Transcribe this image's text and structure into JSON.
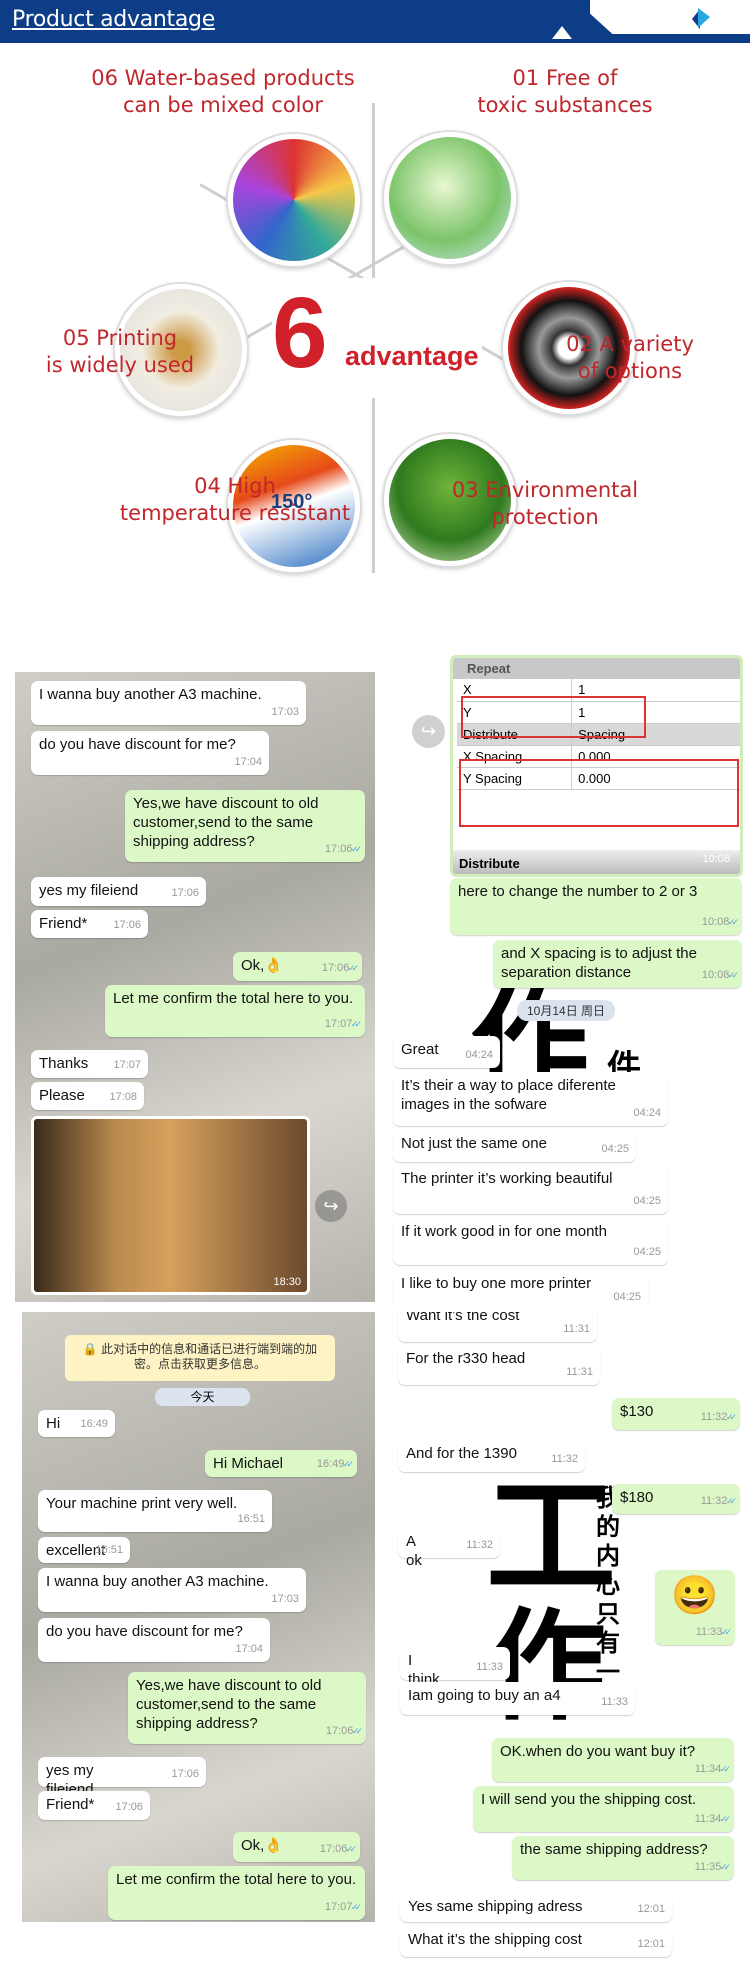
{
  "header": {
    "title": "Product advantage",
    "logo": "diamond-logo",
    "color": "#0d3d87"
  },
  "advantages": {
    "center_number": "6",
    "center_label": "advantage",
    "accent": "#c0262b",
    "items": [
      {
        "line1": "06 Water-based products",
        "line2": "can be mixed color",
        "image": "paint-brushes"
      },
      {
        "line1": "01 Free of",
        "line2": "toxic substances",
        "image": "lightbulb-plant"
      },
      {
        "line1": "05 Printing",
        "line2": "is widely used",
        "image": "pixel-deer"
      },
      {
        "line1": "02 A variety",
        "line2": "of options",
        "image": "metal-ring"
      },
      {
        "line1": "04 High",
        "line2": "temperature resistant",
        "image": "thermometer",
        "image_text": "150°"
      },
      {
        "line1": "03 Environmental",
        "line2": "protection",
        "image": "grass-house"
      }
    ]
  },
  "chats": {
    "top_left": {
      "messages": [
        {
          "dir": "in",
          "text": "I wanna buy another A3 machine.",
          "time": "17:03"
        },
        {
          "dir": "in",
          "text": "do you have discount for me?",
          "time": "17:04"
        },
        {
          "dir": "out",
          "text": "Yes,we have discount to old customer,send to the same shipping address?",
          "time": "17:06"
        },
        {
          "dir": "in",
          "text": "yes my fileiend",
          "time": "17:06"
        },
        {
          "dir": "in",
          "text": "Friend*",
          "time": "17:06"
        },
        {
          "dir": "out",
          "text": "Ok,👌",
          "time": "17:06"
        },
        {
          "dir": "out",
          "text": "Let me confirm the total here to you.",
          "time": "17:07"
        },
        {
          "dir": "in",
          "text": "Thanks",
          "time": "17:07"
        },
        {
          "dir": "in",
          "text": "Please",
          "time": "17:08"
        }
      ],
      "photo_time": "18:30"
    },
    "top_right": {
      "screenshot": {
        "section": "Repeat",
        "rows": [
          [
            "X",
            "1"
          ],
          [
            "Y",
            "1"
          ],
          [
            "Distribute",
            "Spacing"
          ],
          [
            "X Spacing",
            "0.000"
          ],
          [
            "Y Spacing",
            "0.000"
          ]
        ],
        "footer": "Distribute",
        "time": "10:08"
      },
      "date_pill": "10月14日 周日",
      "wallpaper_chars": [
        "作",
        "件"
      ],
      "messages": [
        {
          "dir": "out",
          "text": "here to change the number to 2 or 3",
          "time": "10:08"
        },
        {
          "dir": "out",
          "text": "and X spacing is to adjust the separation distance",
          "time": "10:08"
        },
        {
          "dir": "in",
          "text": "Great",
          "time": "04:24"
        },
        {
          "dir": "in",
          "text": "It’s their a way to place diferente images in the sofware",
          "time": "04:24"
        },
        {
          "dir": "in",
          "text": "Not just the same one",
          "time": "04:25"
        },
        {
          "dir": "in",
          "text": "The printer it’s working beautiful",
          "time": "04:25"
        },
        {
          "dir": "in",
          "text": "If it work good in for one month",
          "time": "04:25"
        },
        {
          "dir": "in",
          "text": "I like to buy one more printer",
          "time": "04:25"
        }
      ]
    },
    "bottom_left": {
      "encryption_notice": "🔒 此对话中的信息和通话已进行端到端的加密。点击获取更多信息。",
      "date_pill": "今天",
      "messages": [
        {
          "dir": "in",
          "text": "Hi",
          "time": "16:49"
        },
        {
          "dir": "out",
          "text": "Hi Michael",
          "time": "16:49"
        },
        {
          "dir": "in",
          "text": "Your machine print very well.",
          "time": "16:51"
        },
        {
          "dir": "in",
          "text": "excellent",
          "time": "16:51"
        },
        {
          "dir": "in",
          "text": "I wanna buy another A3 machine.",
          "time": "17:03"
        },
        {
          "dir": "in",
          "text": "do you have discount for me?",
          "time": "17:04"
        },
        {
          "dir": "out",
          "text": "Yes,we have discount to old customer,send to the same shipping address?",
          "time": "17:06"
        },
        {
          "dir": "in",
          "text": "yes my fileiend",
          "time": "17:06"
        },
        {
          "dir": "in",
          "text": "Friend*",
          "time": "17:06"
        },
        {
          "dir": "out",
          "text": "Ok,👌",
          "time": "17:06"
        },
        {
          "dir": "out",
          "text": "Let me confirm the total here to you.",
          "time": "17:07"
        }
      ]
    },
    "bottom_right": {
      "wallpaper_chars": [
        "工",
        "作"
      ],
      "wallpaper_vertical": "我的内心只有一",
      "messages": [
        {
          "dir": "in",
          "text": "Want it’s the cost",
          "time": "11:31"
        },
        {
          "dir": "in",
          "text": "For the r330 head",
          "time": "11:31"
        },
        {
          "dir": "out",
          "text": "$130",
          "time": "11:32"
        },
        {
          "dir": "in",
          "text": "And for the 1390",
          "time": "11:32"
        },
        {
          "dir": "out",
          "text": "$180",
          "time": "11:32"
        },
        {
          "dir": "in",
          "text": "A ok",
          "time": "11:32"
        },
        {
          "dir": "out",
          "text": "😀",
          "time": "11:33"
        },
        {
          "dir": "in",
          "text": "I think",
          "time": "11:33"
        },
        {
          "dir": "in",
          "text": "Iam going to buy an a4",
          "time": "11:33"
        },
        {
          "dir": "out",
          "text": "OK.when do you want buy it?",
          "time": "11:34"
        },
        {
          "dir": "out",
          "text": "I will send you the shipping cost.",
          "time": "11:34"
        },
        {
          "dir": "out",
          "text": "the same shipping address?",
          "time": "11:35"
        },
        {
          "dir": "in",
          "text": "Yes same shipping adress",
          "time": "12:01"
        },
        {
          "dir": "in",
          "text": "What it’s the shipping cost",
          "time": "12:01"
        }
      ]
    }
  }
}
